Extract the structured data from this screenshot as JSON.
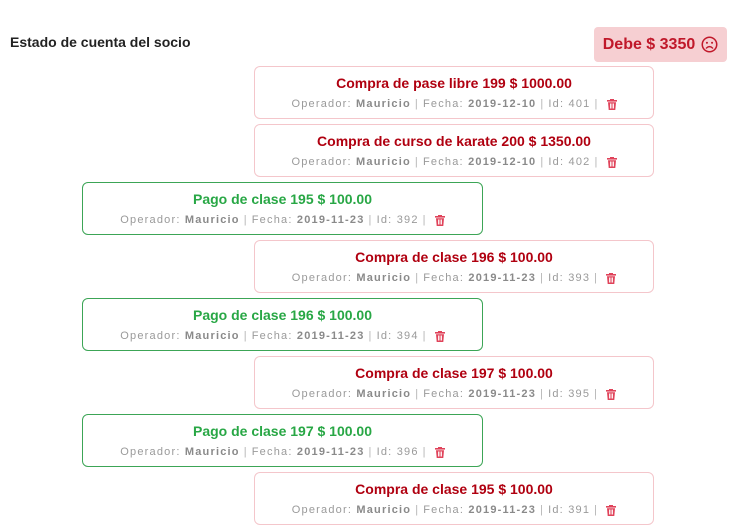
{
  "header": {
    "title": "Estado de cuenta del socio",
    "debt_label": "Debe $ 3350"
  },
  "labels": {
    "operator": "Operador:",
    "date": "Fecha:",
    "id": "Id:"
  },
  "colors": {
    "debt_red": "#c0182a",
    "purchase_border": "#f4c6cb",
    "payment_green": "#28a745",
    "trash_red": "#e0435a"
  },
  "entries": [
    {
      "type": "purchase",
      "title": "Compra de pase libre 199 $ 1000.00",
      "operator": "Mauricio",
      "date": "2019-12-10",
      "id": "401",
      "icon": "trash-icon"
    },
    {
      "type": "purchase",
      "title": "Compra de curso de karate 200 $ 1350.00",
      "operator": "Mauricio",
      "date": "2019-12-10",
      "id": "402",
      "icon": "trash-icon"
    },
    {
      "type": "payment",
      "title": "Pago de clase 195 $ 100.00",
      "operator": "Mauricio",
      "date": "2019-11-23",
      "id": "392",
      "icon": "trash-icon"
    },
    {
      "type": "purchase",
      "title": "Compra de clase 196 $ 100.00",
      "operator": "Mauricio",
      "date": "2019-11-23",
      "id": "393",
      "icon": "trash-icon"
    },
    {
      "type": "payment",
      "title": "Pago de clase 196 $ 100.00",
      "operator": "Mauricio",
      "date": "2019-11-23",
      "id": "394",
      "icon": "trash-icon"
    },
    {
      "type": "purchase",
      "title": "Compra de clase 197 $ 100.00",
      "operator": "Mauricio",
      "date": "2019-11-23",
      "id": "395",
      "icon": "trash-icon"
    },
    {
      "type": "payment",
      "title": "Pago de clase 197 $ 100.00",
      "operator": "Mauricio",
      "date": "2019-11-23",
      "id": "396",
      "icon": "trash-icon"
    },
    {
      "type": "purchase",
      "title": "Compra de clase 195 $ 100.00",
      "operator": "Mauricio",
      "date": "2019-11-23",
      "id": "391",
      "icon": "trash-icon"
    }
  ]
}
